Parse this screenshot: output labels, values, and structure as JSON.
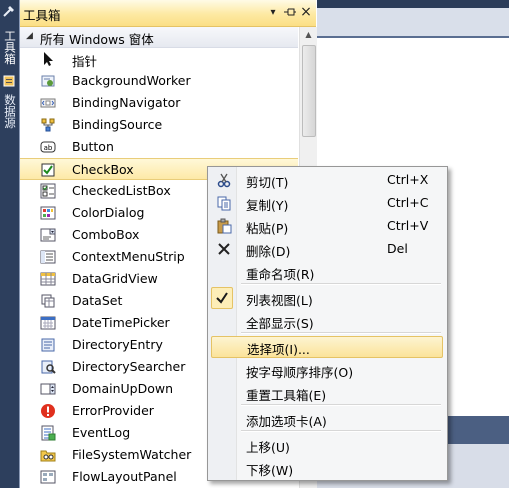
{
  "strip": {
    "tabs": [
      "工具箱",
      "数据源"
    ]
  },
  "toolbox": {
    "title": "工具箱",
    "buttons": {
      "dropdown": "▾",
      "pin": "ᚎ",
      "close": "×"
    },
    "group": "所有 Windows 窗体",
    "items": [
      {
        "label": "指针",
        "icon": "pointer-icon"
      },
      {
        "label": "BackgroundWorker",
        "icon": "backgroundworker-icon"
      },
      {
        "label": "BindingNavigator",
        "icon": "bindingnavigator-icon"
      },
      {
        "label": "BindingSource",
        "icon": "bindingsource-icon"
      },
      {
        "label": "Button",
        "icon": "button-icon"
      },
      {
        "label": "CheckBox",
        "icon": "checkbox-icon",
        "selected": true
      },
      {
        "label": "CheckedListBox",
        "icon": "checkedlistbox-icon"
      },
      {
        "label": "ColorDialog",
        "icon": "colordialog-icon"
      },
      {
        "label": "ComboBox",
        "icon": "combobox-icon"
      },
      {
        "label": "ContextMenuStrip",
        "icon": "contextmenustrip-icon"
      },
      {
        "label": "DataGridView",
        "icon": "datagridview-icon"
      },
      {
        "label": "DataSet",
        "icon": "dataset-icon"
      },
      {
        "label": "DateTimePicker",
        "icon": "datetimepicker-icon"
      },
      {
        "label": "DirectoryEntry",
        "icon": "directoryentry-icon"
      },
      {
        "label": "DirectorySearcher",
        "icon": "directorysearcher-icon"
      },
      {
        "label": "DomainUpDown",
        "icon": "domainupdown-icon"
      },
      {
        "label": "ErrorProvider",
        "icon": "errorprovider-icon"
      },
      {
        "label": "EventLog",
        "icon": "eventlog-icon"
      },
      {
        "label": "FileSystemWatcher",
        "icon": "filesystemwatcher-icon"
      },
      {
        "label": "FlowLayoutPanel",
        "icon": "flowlayoutpanel-icon"
      }
    ]
  },
  "context_menu": {
    "items": [
      {
        "label": "剪切(T)",
        "shortcut": "Ctrl+X",
        "icon": "cut-icon"
      },
      {
        "label": "复制(Y)",
        "shortcut": "Ctrl+C",
        "icon": "copy-icon"
      },
      {
        "label": "粘贴(P)",
        "shortcut": "Ctrl+V",
        "icon": "paste-icon"
      },
      {
        "label": "删除(D)",
        "shortcut": "Del",
        "icon": "delete-icon"
      },
      {
        "label": "重命名项(R)",
        "shortcut": ""
      },
      {
        "label": "列表视图(L)",
        "shortcut": "",
        "checked": true,
        "icon": "checkmark-icon"
      },
      {
        "label": "全部显示(S)",
        "shortcut": ""
      },
      {
        "label": "选择项(I)...",
        "shortcut": "",
        "highlighted": true
      },
      {
        "label": "按字母顺序排序(O)",
        "shortcut": ""
      },
      {
        "label": "重置工具箱(E)",
        "shortcut": ""
      },
      {
        "label": "添加选项卡(A)",
        "shortcut": ""
      },
      {
        "label": "上移(U)",
        "shortcut": ""
      },
      {
        "label": "下移(W)",
        "shortcut": ""
      }
    ]
  },
  "colors": {
    "titlebar": "#fde9a2",
    "selection": "#fde9a7",
    "ide_background": "#2b3c59"
  }
}
